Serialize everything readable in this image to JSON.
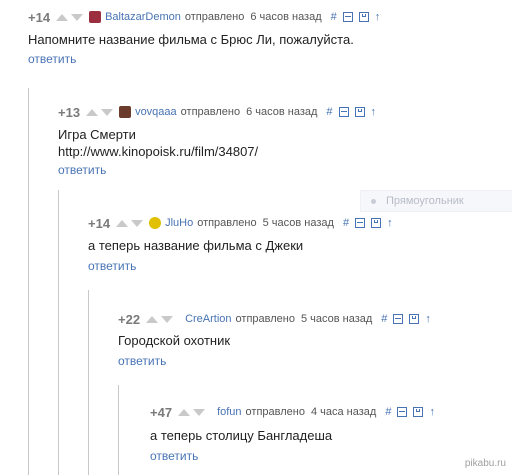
{
  "common": {
    "sent_label": "отправлено",
    "reply_label": "ответить",
    "hash": "#"
  },
  "comments": [
    {
      "rating": "+14",
      "nick": "BaltazarDemon",
      "time": "6 часов назад",
      "avatar_color": "#9b2f3f",
      "text": [
        "Напомните название фильма с Брюс Ли, пожалуйста."
      ]
    },
    {
      "rating": "+13",
      "nick": "vovqaaa",
      "time": "6 часов назад",
      "avatar_color": "#6b3b2b",
      "text": [
        "Игра Смерти",
        "http://www.kinopoisk.ru/film/34807/"
      ]
    },
    {
      "rating": "+14",
      "nick": "JluHo",
      "time": "5 часов назад",
      "avatar_color": "#e0c000",
      "text": [
        "а теперь название фильма с Джеки"
      ]
    },
    {
      "rating": "+22",
      "nick": "CreArtion",
      "time": "5 часов назад",
      "avatar_color": "",
      "text": [
        "Городской охотник"
      ]
    },
    {
      "rating": "+47",
      "nick": "fofun",
      "time": "4 часа назад",
      "avatar_color": "",
      "text": [
        "а теперь столицу Бангладеша"
      ]
    }
  ],
  "tooltip": {
    "label": "Прямоугольник"
  },
  "watermark": "pikabu.ru"
}
